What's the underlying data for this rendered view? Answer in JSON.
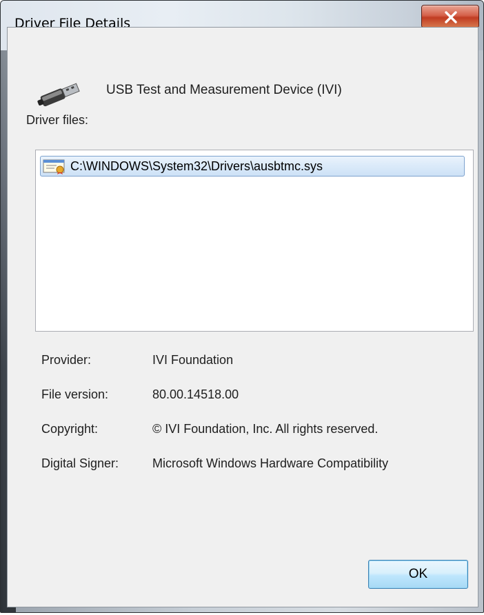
{
  "window": {
    "title": "Driver File Details",
    "close_glyph": "✕"
  },
  "device": {
    "icon": "usb-plug-icon",
    "name": "USB Test and Measurement Device (IVI)"
  },
  "files": {
    "label": "Driver files:",
    "items": [
      {
        "icon": "signed-file-icon",
        "path": "C:\\WINDOWS\\System32\\Drivers\\ausbtmc.sys",
        "selected": true
      }
    ]
  },
  "details": {
    "provider_label": "Provider:",
    "provider_value": "IVI Foundation",
    "version_label": "File version:",
    "version_value": "80.00.14518.00",
    "copyright_label": "Copyright:",
    "copyright_value": "© IVI Foundation, Inc. All rights reserved.",
    "signer_label": "Digital Signer:",
    "signer_value": "Microsoft Windows Hardware Compatibility"
  },
  "buttons": {
    "ok_label": "OK"
  },
  "colors": {
    "accent": "#3c7fb1",
    "selection": "#cde1f6",
    "close_red": "#c13c22"
  }
}
